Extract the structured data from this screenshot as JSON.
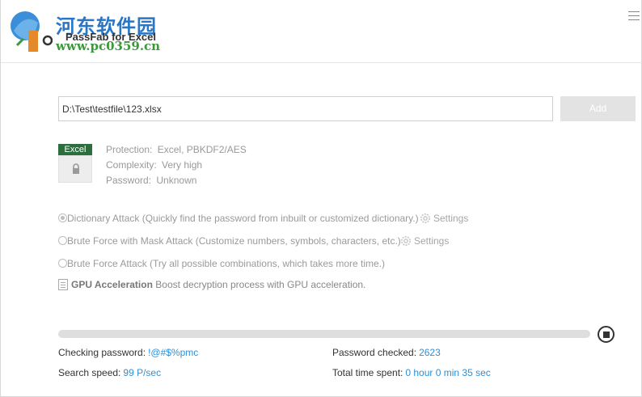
{
  "watermark": {
    "title": "河东软件园",
    "url": "www.pc0359.cn"
  },
  "app": {
    "name": "PassFab for Excel"
  },
  "file": {
    "path": "D:\\Test\\testfile\\123.xlsx",
    "add_label": "Add",
    "type_badge": "Excel"
  },
  "info": {
    "protection_label": "Protection:",
    "protection_value": "Excel, PBKDF2/AES",
    "complexity_label": "Complexity:",
    "complexity_value": "Very high",
    "password_label": "Password:",
    "password_value": "Unknown"
  },
  "attacks": [
    {
      "label": "Dictionary Attack (Quickly find the password from inbuilt or customized dictionary.)",
      "selected": true,
      "settings": "Settings"
    },
    {
      "label": "Brute Force with Mask Attack (Customize numbers, symbols, characters, etc.)",
      "selected": false,
      "settings": "Settings"
    },
    {
      "label": "Brute Force Attack (Try all possible combinations, which takes more time.)",
      "selected": false
    }
  ],
  "gpu": {
    "title": "GPU Acceleration",
    "desc": "Boost decryption process with GPU acceleration."
  },
  "progress": {
    "fraction": 0.0
  },
  "stats": {
    "checking_label": "Checking password:",
    "checking_value": "!@#$%pmc",
    "checked_label": "Password checked:",
    "checked_value": "2623",
    "speed_label": "Search speed:",
    "speed_value": "99 P/sec",
    "time_label": "Total time spent:",
    "time_value": "0 hour 0 min 35 sec"
  },
  "colors": {
    "accent": "#2d8fd5",
    "excel_badge": "#2d6e3e",
    "watermark_blue": "#2a76c6",
    "watermark_green": "#3a9a3a"
  }
}
